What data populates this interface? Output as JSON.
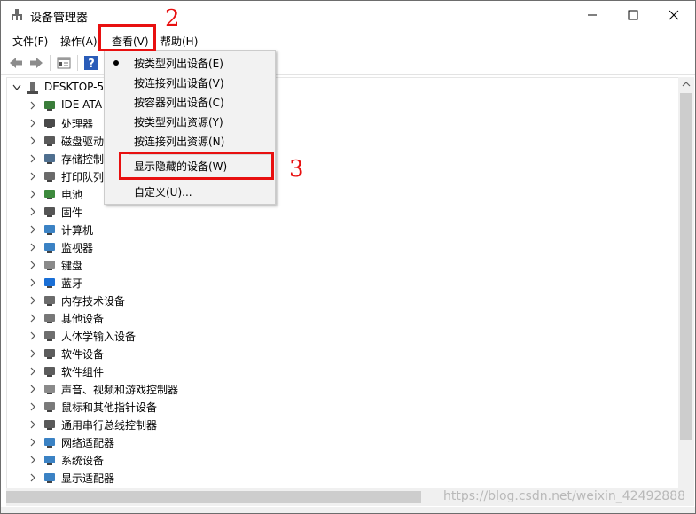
{
  "window": {
    "title": "设备管理器",
    "caption_min": "—",
    "caption_max": "☐",
    "caption_close": "✕"
  },
  "menubar": {
    "file": "文件(F)",
    "action": "操作(A)",
    "view": "查看(V)",
    "help": "帮助(H)"
  },
  "view_menu": {
    "items": [
      {
        "label": "按类型列出设备(E)",
        "checked": true
      },
      {
        "label": "按连接列出设备(V)",
        "checked": false
      },
      {
        "label": "按容器列出设备(C)",
        "checked": false
      },
      {
        "label": "按类型列出资源(Y)",
        "checked": false
      },
      {
        "label": "按连接列出资源(N)",
        "checked": false
      },
      {
        "label": "显示隐藏的设备(W)",
        "checked": false
      },
      {
        "label": "自定义(U)...",
        "checked": false
      }
    ]
  },
  "tree": {
    "root": "DESKTOP-5",
    "items": [
      {
        "label": "IDE ATA",
        "icon": "ide-controller-icon"
      },
      {
        "label": "处理器",
        "icon": "processor-icon"
      },
      {
        "label": "磁盘驱动",
        "icon": "disk-drive-icon"
      },
      {
        "label": "存储控制",
        "icon": "storage-controller-icon"
      },
      {
        "label": "打印队列",
        "icon": "printer-icon"
      },
      {
        "label": "电池",
        "icon": "battery-icon"
      },
      {
        "label": "固件",
        "icon": "firmware-icon"
      },
      {
        "label": "计算机",
        "icon": "computer-icon"
      },
      {
        "label": "监视器",
        "icon": "monitor-icon"
      },
      {
        "label": "键盘",
        "icon": "keyboard-icon"
      },
      {
        "label": "蓝牙",
        "icon": "bluetooth-icon"
      },
      {
        "label": "内存技术设备",
        "icon": "memory-icon"
      },
      {
        "label": "其他设备",
        "icon": "other-device-icon"
      },
      {
        "label": "人体学输入设备",
        "icon": "hid-icon"
      },
      {
        "label": "软件设备",
        "icon": "software-device-icon"
      },
      {
        "label": "软件组件",
        "icon": "software-component-icon"
      },
      {
        "label": "声音、视频和游戏控制器",
        "icon": "speaker-icon"
      },
      {
        "label": "鼠标和其他指针设备",
        "icon": "mouse-icon"
      },
      {
        "label": "通用串行总线控制器",
        "icon": "usb-icon"
      },
      {
        "label": "网络适配器",
        "icon": "network-adapter-icon"
      },
      {
        "label": "系统设备",
        "icon": "system-device-icon"
      },
      {
        "label": "显示适配器",
        "icon": "display-adapter-icon"
      }
    ]
  },
  "annotations": {
    "step2": "2",
    "step3": "3"
  },
  "watermark": "https://blog.csdn.net/weixin_42492888",
  "colors": {
    "highlight_red": "#e81010",
    "menu_bg": "#f2f2f2"
  }
}
